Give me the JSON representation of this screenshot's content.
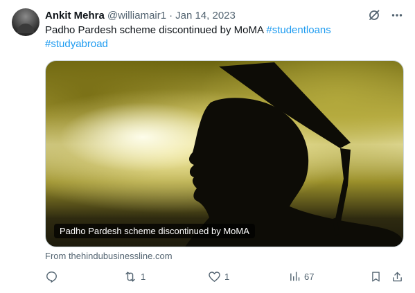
{
  "post": {
    "author_name": "Ankit Mehra",
    "handle": "@williamair1",
    "separator": "·",
    "date": "Jan 14, 2023",
    "text": "Padho Pardesh scheme discontinued by MoMA",
    "hashtags": [
      "#studentloans",
      "#studyabroad"
    ]
  },
  "media": {
    "caption": "Padho Pardesh scheme discontinued by MoMA",
    "source": "From thehindubusinessline.com"
  },
  "actions": {
    "reply_count": "",
    "repost_count": "1",
    "like_count": "1",
    "views_count": "67"
  },
  "icons": {
    "grok": "slashed-circle-icon",
    "more": "more-horizontal-icon",
    "reply": "reply-icon",
    "repost": "repost-icon",
    "like": "heart-icon",
    "views": "views-bar-icon",
    "bookmark": "bookmark-icon",
    "share": "share-icon"
  },
  "colors": {
    "link": "#1d9bf0",
    "muted": "#536471",
    "text": "#0f1419"
  }
}
